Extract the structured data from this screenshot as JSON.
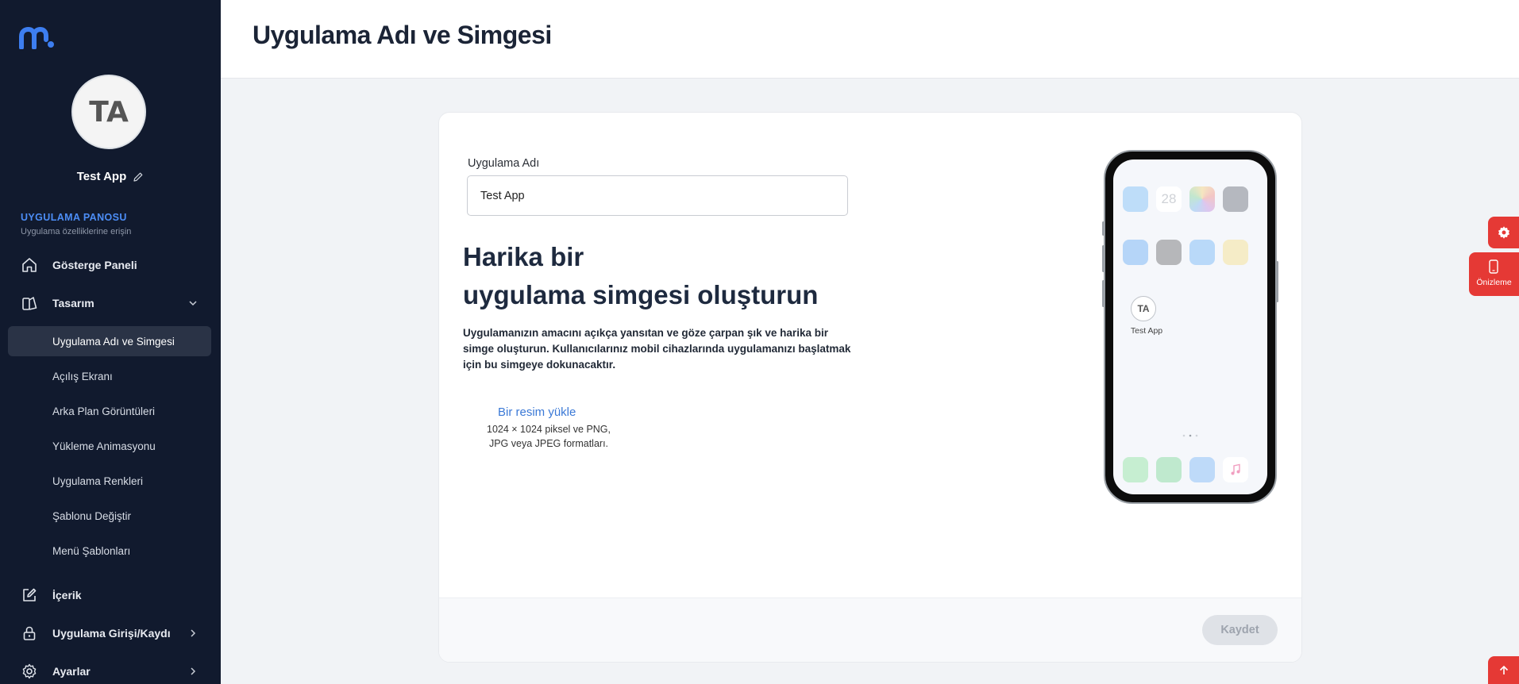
{
  "brand": {
    "logo_icon": "mobiroller-logo",
    "accent": "#3d7ef0"
  },
  "sidebar": {
    "avatar_initials": "TA",
    "app_name": "Test App",
    "section_title": "UYGULAMA PANOSU",
    "section_subtitle": "Uygulama özelliklerine erişin",
    "items": [
      {
        "label": "Gösterge Paneli",
        "icon": "home-icon"
      },
      {
        "label": "Tasarım",
        "icon": "design-icon",
        "expanded": true
      },
      {
        "label": "İçerik",
        "icon": "edit-icon"
      },
      {
        "label": "Uygulama Girişi/Kaydı",
        "icon": "lock-icon"
      },
      {
        "label": "Ayarlar",
        "icon": "gear-icon"
      }
    ],
    "design_subitems": [
      "Uygulama Adı ve Simgesi",
      "Açılış Ekranı",
      "Arka Plan Görüntüleri",
      "Yükleme Animasyonu",
      "Uygulama Renkleri",
      "Şablonu Değiştir",
      "Menü Şablonları"
    ],
    "active_subitem": "Uygulama Adı ve Simgesi"
  },
  "header": {
    "title": "Uygulama Adı ve Simgesi"
  },
  "form": {
    "app_name_label": "Uygulama Adı",
    "app_name_value": "Test App",
    "headline_line1": "Harika bir",
    "headline_line2": "uygulama simgesi oluşturun",
    "description": "Uygulamanızın amacını açıkça yansıtan ve göze çarpan şık ve harika bir simge oluşturun. Kullanıcılarınız mobil cihazlarında uygulamanızı başlatmak için bu simgeye dokunacaktır.",
    "upload_link": "Bir resim yükle",
    "upload_hint_line1": "1024 × 1024 piksel ve PNG,",
    "upload_hint_line2": "JPG veya JPEG formatları.",
    "save_button": "Kaydet"
  },
  "phone_preview": {
    "calendar_day": "28",
    "app_initials": "TA",
    "app_label": "Test App"
  },
  "floating": {
    "settings_icon": "gear-icon",
    "preview_label": "Önizleme",
    "scroll_top_icon": "arrow-up-icon",
    "color": "#e53935"
  }
}
